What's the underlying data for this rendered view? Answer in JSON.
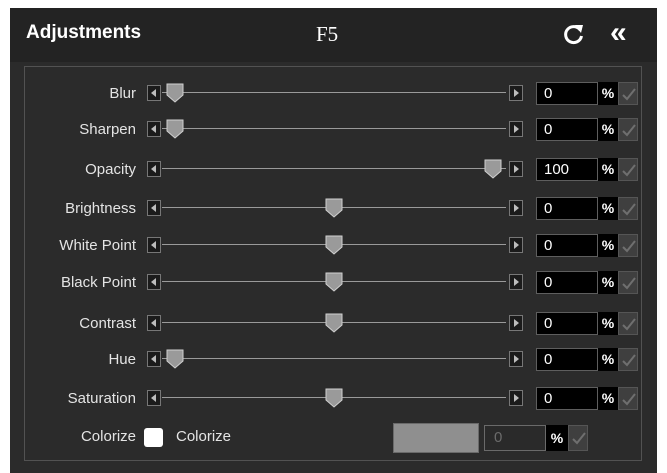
{
  "header": {
    "title": "Adjustments",
    "hotkey": "F5",
    "reset_icon": "reset-icon",
    "collapse_icon": "double-chevron-left-icon"
  },
  "sliders": [
    {
      "label": "Blur",
      "value": "0",
      "unit": "%",
      "level": 0.0
    },
    {
      "label": "Sharpen",
      "value": "0",
      "unit": "%",
      "level": 0.0
    },
    {
      "label": "Opacity",
      "value": "100",
      "unit": "%",
      "level": 1.0
    },
    {
      "label": "Brightness",
      "value": "0",
      "unit": "%",
      "level": 0.5
    },
    {
      "label": "White Point",
      "value": "0",
      "unit": "%",
      "level": 0.5
    },
    {
      "label": "Black Point",
      "value": "0",
      "unit": "%",
      "level": 0.5
    },
    {
      "label": "Contrast",
      "value": "0",
      "unit": "%",
      "level": 0.5
    },
    {
      "label": "Hue",
      "value": "0",
      "unit": "%",
      "level": 0.0
    },
    {
      "label": "Saturation",
      "value": "0",
      "unit": "%",
      "level": 0.5
    }
  ],
  "colorize": {
    "label": "Colorize",
    "checkbox_label": "Colorize",
    "checked": false,
    "swatch_color": "#8f8f8f",
    "value": "0",
    "unit": "%"
  },
  "colors": {
    "panel_bg": "#2b2b2b",
    "header_bg": "#232323",
    "field_bg": "#000000"
  }
}
